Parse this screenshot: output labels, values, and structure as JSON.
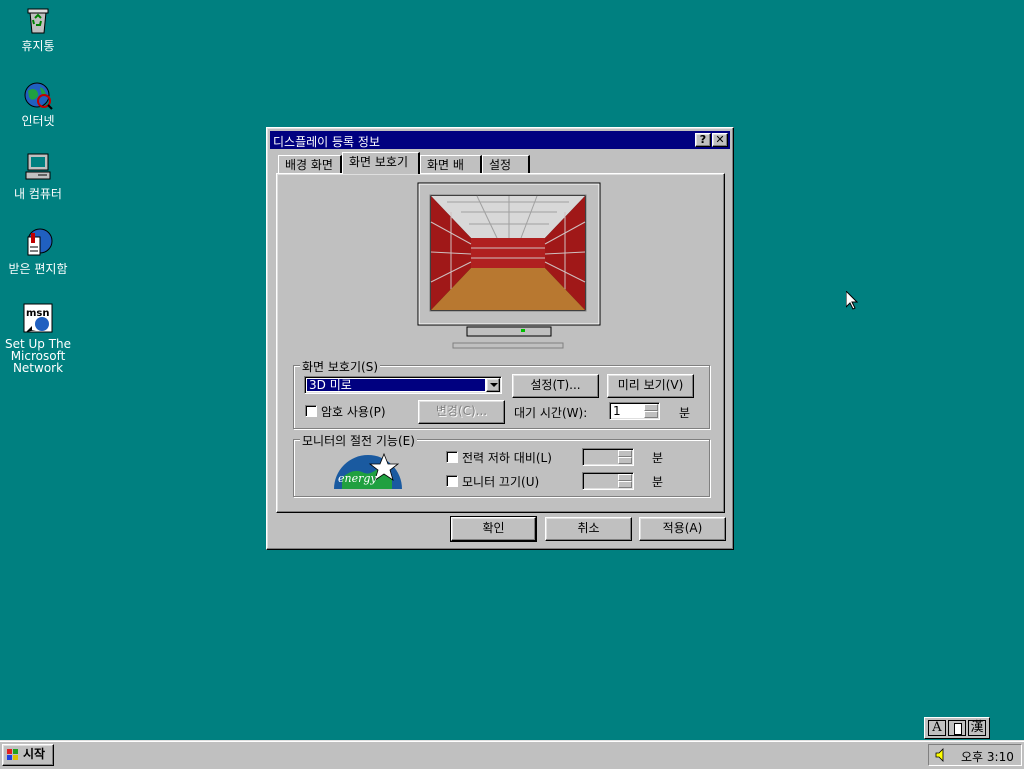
{
  "desktop": {
    "icons": [
      {
        "label": "휴지통",
        "icon": "recycle-bin-icon"
      },
      {
        "label": "인터넷",
        "icon": "internet-explorer-icon"
      },
      {
        "label": "내 컴퓨터",
        "icon": "my-computer-icon"
      },
      {
        "label": "받은 편지함",
        "icon": "inbox-icon"
      },
      {
        "label": "Set Up The\nMicrosoft\nNetwork",
        "icon": "msn-icon"
      }
    ]
  },
  "dialog": {
    "title": "디스플레이 등록 정보",
    "help_button": "?",
    "close_button": "✕",
    "tabs": [
      {
        "label": "배경 화면"
      },
      {
        "label": "화면 보호기"
      },
      {
        "label": "화면 배색"
      },
      {
        "label": "설정"
      }
    ],
    "active_tab": "화면 보호기",
    "screensaver": {
      "group_title": "화면 보호기(S)",
      "selected": "3D 미로",
      "settings_button": "설정(T)...",
      "preview_button": "미리 보기(V)",
      "password_checkbox": "암호 사용(P)",
      "password_checked": false,
      "change_button": "변경(C)...",
      "wait_label": "대기 시간(W):",
      "wait_value": "1",
      "wait_unit": "분"
    },
    "power": {
      "group_title": "모니터의 절전 기능(E)",
      "standby_label": "전력 저하 대비(L)",
      "standby_checked": false,
      "standby_value": "",
      "standby_unit": "분",
      "off_label": "모니터 끄기(U)",
      "off_checked": false,
      "off_value": "",
      "off_unit": "분"
    },
    "ok_button": "확인",
    "cancel_button": "취소",
    "apply_button": "적용(A)"
  },
  "taskbar": {
    "start_label": "시작",
    "clock": "오후 3:10",
    "ime_keys": [
      "A",
      "",
      "漢"
    ]
  },
  "colors": {
    "desktop": "#008080",
    "titlebar": "#000080",
    "face": "#c0c0c0"
  }
}
